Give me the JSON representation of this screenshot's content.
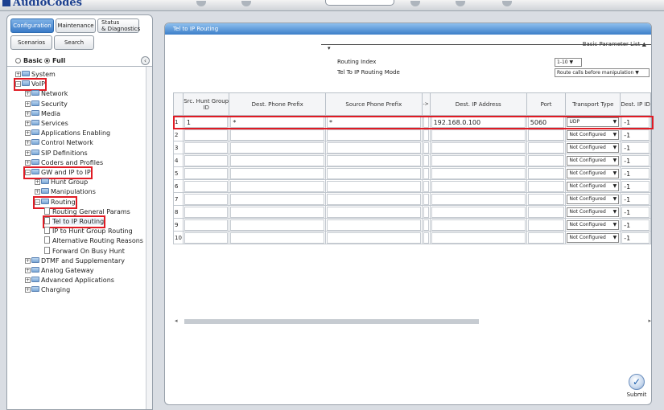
{
  "app": {
    "logo_text": "AudioCodes"
  },
  "tabs": {
    "configuration": "Configuration",
    "maintenance": "Maintenance",
    "status_line1": "Status",
    "status_line2": "& Diagnostics",
    "scenarios": "Scenarios",
    "search": "Search"
  },
  "view_mode": {
    "basic": "Basic",
    "full": "Full",
    "selected": "Full"
  },
  "tree": [
    {
      "label": "System",
      "toggle": "+"
    },
    {
      "label": "VoIP",
      "toggle": "−"
    },
    {
      "label": "Network",
      "toggle": "+"
    },
    {
      "label": "Security",
      "toggle": "+"
    },
    {
      "label": "Media",
      "toggle": "+"
    },
    {
      "label": "Services",
      "toggle": "+"
    },
    {
      "label": "Applications Enabling",
      "toggle": "+"
    },
    {
      "label": "Control Network",
      "toggle": "+"
    },
    {
      "label": "SIP Definitions",
      "toggle": "+"
    },
    {
      "label": "Coders and Profiles",
      "toggle": "+"
    },
    {
      "label": "GW and IP to IP",
      "toggle": "−"
    },
    {
      "label": "Hunt Group",
      "toggle": "+"
    },
    {
      "label": "Manipulations",
      "toggle": "+"
    },
    {
      "label": "Routing",
      "toggle": "−"
    },
    {
      "label": "Routing General Params",
      "toggle": ""
    },
    {
      "label": "Tel to IP Routing",
      "toggle": ""
    },
    {
      "label": "IP to Hunt Group Routing",
      "toggle": ""
    },
    {
      "label": "Alternative Routing Reasons",
      "toggle": ""
    },
    {
      "label": "Forward On Busy Hunt",
      "toggle": ""
    },
    {
      "label": "DTMF and Supplementary",
      "toggle": "+"
    },
    {
      "label": "Analog Gateway",
      "toggle": "+"
    },
    {
      "label": "Advanced Applications",
      "toggle": "+"
    },
    {
      "label": "Charging",
      "toggle": "+"
    }
  ],
  "page": {
    "title": "Tel to IP Routing",
    "basic_param_list": "Basic Parameter List ▲",
    "routing_index_label": "Routing Index",
    "routing_index_value": "1-10 ▼",
    "mode_label": "Tel To IP Routing Mode",
    "mode_value": "Route calls before manipulation ▼"
  },
  "table": {
    "headers": [
      "Src. Hunt Group ID",
      "Dest. Phone Prefix",
      "Source Phone Prefix",
      "->",
      "Dest. IP Address",
      "Port",
      "Transport Type",
      "Dest. IP ID"
    ],
    "rows": [
      {
        "idx": "1",
        "src": "1",
        "dest_prefix": "*",
        "src_prefix": "*",
        "ip": "192.168.0.100",
        "port": "5060",
        "transport": "UDP",
        "dest_id": "-1"
      },
      {
        "idx": "2",
        "src": "",
        "dest_prefix": "",
        "src_prefix": "",
        "ip": "",
        "port": "",
        "transport": "Not Configured",
        "dest_id": "-1"
      },
      {
        "idx": "3",
        "src": "",
        "dest_prefix": "",
        "src_prefix": "",
        "ip": "",
        "port": "",
        "transport": "Not Configured",
        "dest_id": "-1"
      },
      {
        "idx": "4",
        "src": "",
        "dest_prefix": "",
        "src_prefix": "",
        "ip": "",
        "port": "",
        "transport": "Not Configured",
        "dest_id": "-1"
      },
      {
        "idx": "5",
        "src": "",
        "dest_prefix": "",
        "src_prefix": "",
        "ip": "",
        "port": "",
        "transport": "Not Configured",
        "dest_id": "-1"
      },
      {
        "idx": "6",
        "src": "",
        "dest_prefix": "",
        "src_prefix": "",
        "ip": "",
        "port": "",
        "transport": "Not Configured",
        "dest_id": "-1"
      },
      {
        "idx": "7",
        "src": "",
        "dest_prefix": "",
        "src_prefix": "",
        "ip": "",
        "port": "",
        "transport": "Not Configured",
        "dest_id": "-1"
      },
      {
        "idx": "8",
        "src": "",
        "dest_prefix": "",
        "src_prefix": "",
        "ip": "",
        "port": "",
        "transport": "Not Configured",
        "dest_id": "-1"
      },
      {
        "idx": "9",
        "src": "",
        "dest_prefix": "",
        "src_prefix": "",
        "ip": "",
        "port": "",
        "transport": "Not Configured",
        "dest_id": "-1"
      },
      {
        "idx": "10",
        "src": "",
        "dest_prefix": "",
        "src_prefix": "",
        "ip": "",
        "port": "",
        "transport": "Not Configured",
        "dest_id": "-1"
      }
    ]
  },
  "submit_label": "Submit",
  "colors": {
    "highlight": "#e01b24",
    "header_blue": "#3c7fc9"
  }
}
